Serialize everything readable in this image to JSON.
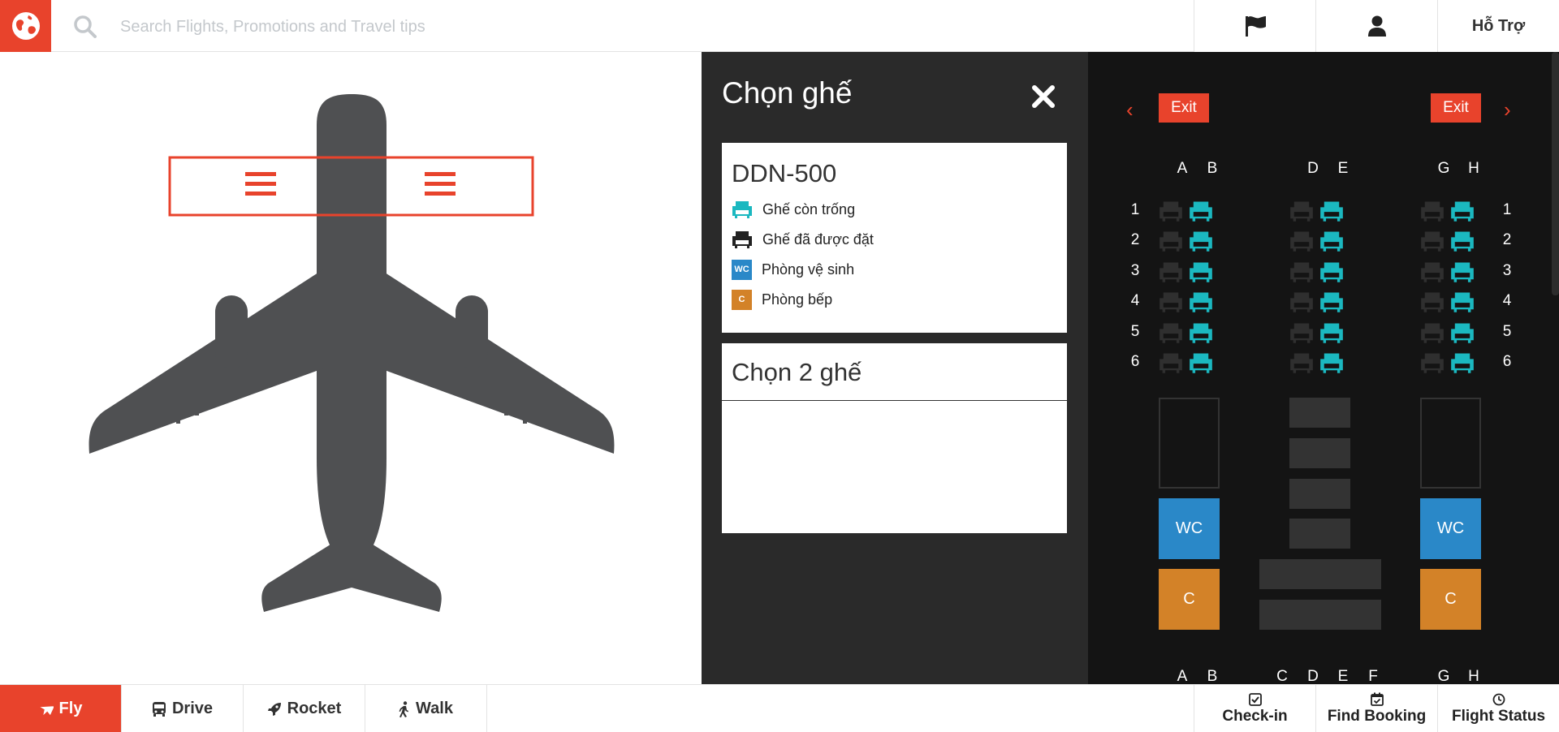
{
  "header": {
    "search_placeholder": "Search Flights, Promotions and Travel tips",
    "help_label": "Hỗ Trợ",
    "icons": [
      "logo-globe-icon",
      "search-icon",
      "flag-icon",
      "user-icon"
    ]
  },
  "panel": {
    "title": "Chọn ghế",
    "flight_code": "DDN-500",
    "legend": [
      {
        "label": "Ghế còn trống",
        "icon": "seat-available-icon",
        "color": "#1bb8c0"
      },
      {
        "label": "Ghế đã được đặt",
        "icon": "seat-booked-icon",
        "color": "#222222"
      },
      {
        "label": "Phòng vệ sinh",
        "icon": "wc-icon",
        "badge": "WC",
        "color": "#2a88c8"
      },
      {
        "label": "Phòng bếp",
        "icon": "kitchen-icon",
        "badge": "C",
        "color": "#d38228"
      }
    ],
    "select_title": "Chọn 2 ghế"
  },
  "seatmap": {
    "exit_left": "Exit",
    "exit_right": "Exit",
    "top_columns": [
      "A",
      "B",
      "D",
      "E",
      "G",
      "H"
    ],
    "rows": [
      "1",
      "2",
      "3",
      "4",
      "5",
      "6"
    ],
    "seat_status": "columns A, D, G booked; columns B, E, H available in rows 1–6",
    "wc_label": "WC",
    "kitchen_label": "C",
    "bottom_columns": [
      "A",
      "B",
      "C",
      "D",
      "E",
      "F",
      "G",
      "H"
    ]
  },
  "modes": [
    {
      "label": "Fly",
      "icon": "plane-icon",
      "active": true
    },
    {
      "label": "Drive",
      "icon": "bus-icon",
      "active": false
    },
    {
      "label": "Rocket",
      "icon": "rocket-icon",
      "active": false
    },
    {
      "label": "Walk",
      "icon": "walk-icon",
      "active": false
    }
  ],
  "actions": [
    {
      "label": "Check-in",
      "icon": "check-square-icon"
    },
    {
      "label": "Find Booking",
      "icon": "calendar-check-icon"
    },
    {
      "label": "Flight Status",
      "icon": "clock-icon"
    }
  ],
  "colors": {
    "accent": "#e8432c",
    "seat_available": "#1bb8c0",
    "seat_booked": "#2f2f2f",
    "wc": "#2a88c8",
    "kitchen": "#d38228",
    "plane": "#4f5052"
  }
}
